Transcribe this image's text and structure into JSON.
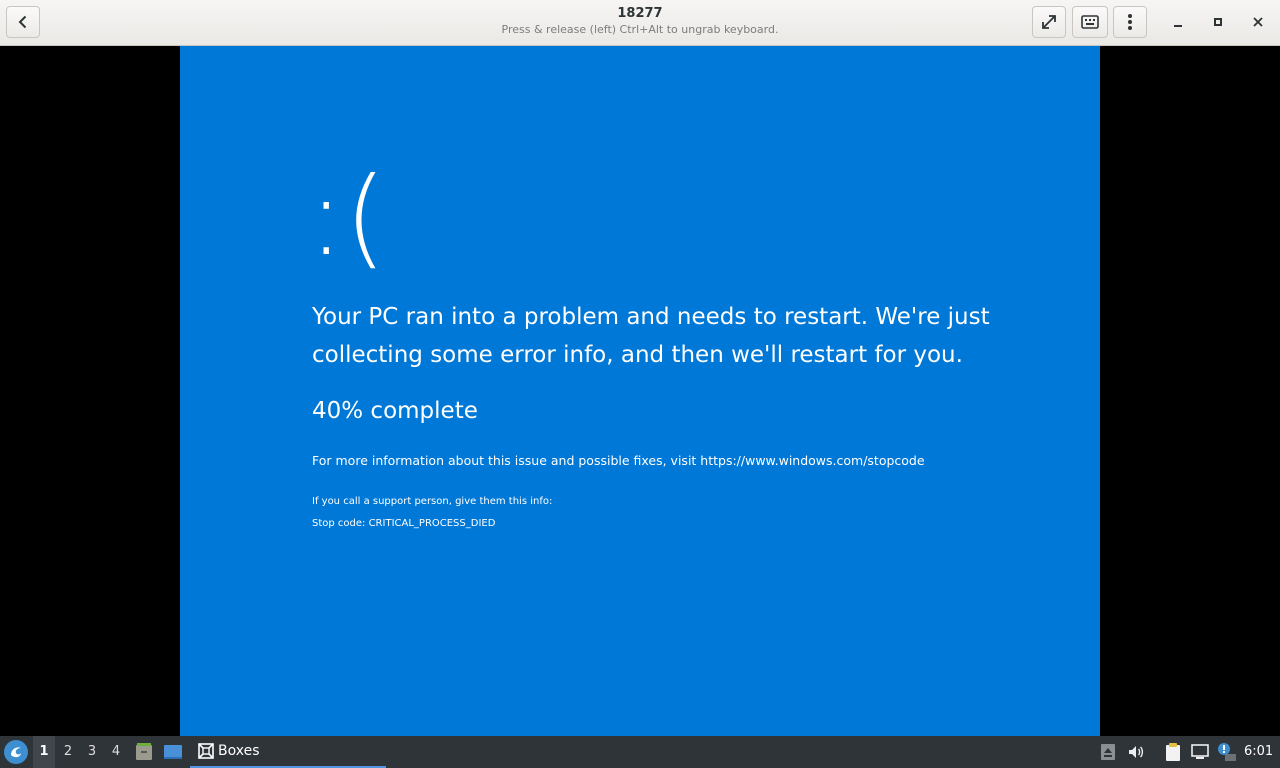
{
  "window": {
    "title": "18277",
    "subtitle": "Press & release (left) Ctrl+Alt to ungrab keyboard."
  },
  "header_buttons": [
    "back-icon",
    "fullscreen-icon",
    "keyboard-icon",
    "menu-icon",
    "minimize-icon",
    "maximize-icon",
    "close-icon"
  ],
  "bsod": {
    "face": ":(",
    "message": "Your PC ran into a problem and needs to restart. We're just collecting some error info, and then we'll restart for you.",
    "progress": "40% complete",
    "info": "For more information about this issue and possible fixes, visit https://www.windows.com/stopcode",
    "support": "If you call a support person, give them this info:",
    "stop_code": "Stop code: CRITICAL_PROCESS_DIED",
    "background_color": "#0078d7"
  },
  "taskbar": {
    "workspaces": [
      "1",
      "2",
      "3",
      "4"
    ],
    "active_workspace": "1",
    "task_label": "Boxes",
    "clock": "6:01",
    "background_color": "#2f3439"
  }
}
